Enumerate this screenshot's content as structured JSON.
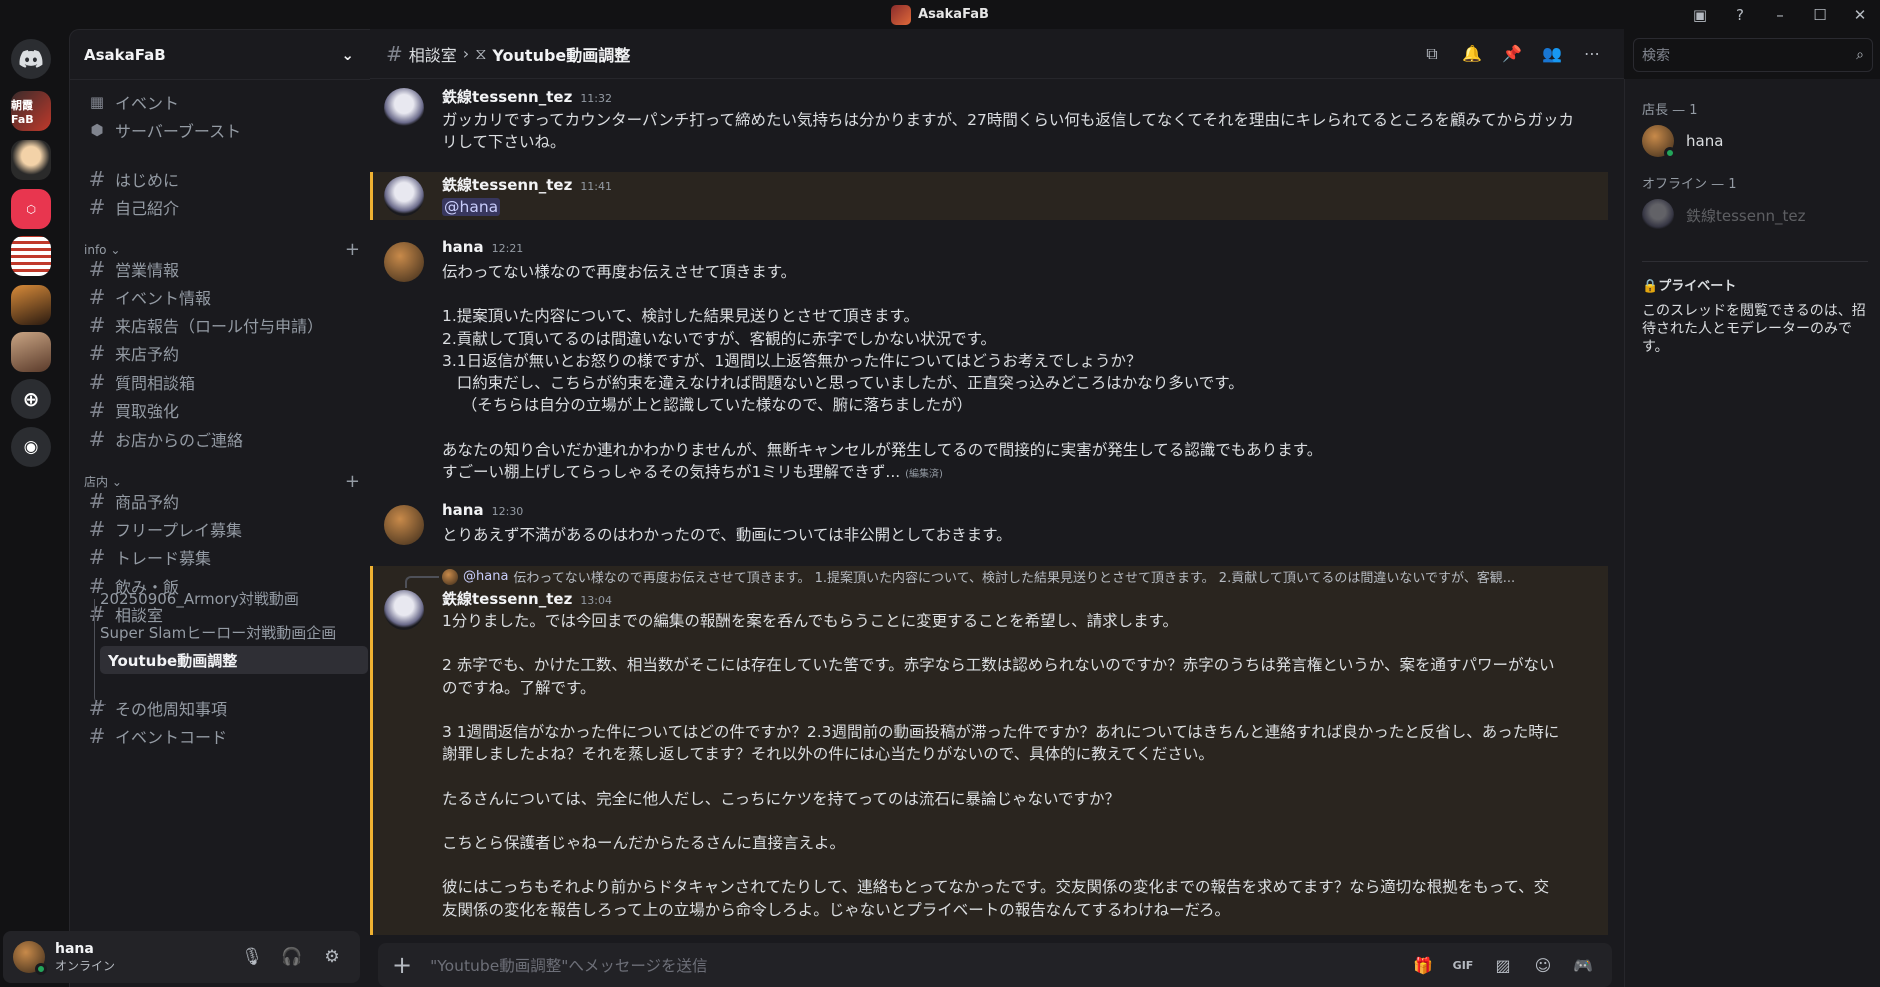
{
  "window": {
    "title": "AsakaFaB"
  },
  "servers": [
    {
      "name": "朝霞FaB"
    },
    {
      "name": "server-2"
    },
    {
      "name": "server-3"
    },
    {
      "name": "server-4"
    },
    {
      "name": "server-5"
    },
    {
      "name": "server-6"
    }
  ],
  "guild": {
    "name": "AsakaFaB"
  },
  "top_items": [
    {
      "label": "イベント"
    },
    {
      "label": "サーバーブースト"
    }
  ],
  "channels_top": [
    {
      "label": "はじめに"
    },
    {
      "label": "自己紹介"
    }
  ],
  "categories": [
    {
      "name": "info",
      "channels": [
        {
          "label": "営業情報"
        },
        {
          "label": "イベント情報"
        },
        {
          "label": "来店報告（ロール付与申請）"
        },
        {
          "label": "来店予約"
        },
        {
          "label": "質問相談箱"
        },
        {
          "label": "買取強化"
        },
        {
          "label": "お店からのご連絡"
        }
      ]
    },
    {
      "name": "店内",
      "channels": [
        {
          "label": "商品予約"
        },
        {
          "label": "フリープレイ募集"
        },
        {
          "label": "トレード募集"
        },
        {
          "label": "飲み・飯"
        },
        {
          "label": "相談室"
        }
      ]
    }
  ],
  "threads": [
    {
      "label": "20250906_Armory対戦動画"
    },
    {
      "label": "Super Slamヒーロー対戦動画企画"
    },
    {
      "label": "Youtube動画調整"
    }
  ],
  "channels_after": [
    {
      "label": "その他周知事項"
    },
    {
      "label": "イベントコード"
    }
  ],
  "user": {
    "name": "hana",
    "status": "オンライン"
  },
  "header": {
    "parent": "相談室",
    "thread": "Youtube動画調整"
  },
  "search": {
    "placeholder": "検索"
  },
  "messages": [
    {
      "author": "鉄線tessenn_tez",
      "time": "11:32",
      "body": "ガッカリですってカウンターパンチ打って締めたい気持ちは分かりますが、27時間くらい何も返信してなくてそれを理由にキレられてるところを顧みてからガッカリして下さいね。"
    },
    {
      "author": "鉄線tessenn_tez",
      "time": "11:41",
      "mention": "@hana"
    },
    {
      "author": "hana",
      "time": "12:21",
      "body": "伝わってない様なので再度お伝えさせて頂きます。\n\n1.提案頂いた内容について、検討した結果見送りとさせて頂きます。\n2.貢献して頂いてるのは間違いないですが、客観的に赤字でしかない状況です。\n3.1日返信が無いとお怒りの様ですが、1週間以上返答無かった件についてはどうお考えでしょうか？\n   口約束だし、こちらが約束を違えなければ問題ないと思っていましたが、正直突っ込みどころはかなり多いです。\n    （そちらは自分の立場が上と認識していた様なので、腑に落ちましたが）\n\nあなたの知り合いだか連れかわかりませんが、無断キャンセルが発生してるので間接的に実害が発生してる認識でもあります。\nすごーい棚上げしてらっしゃるその気持ちが1ミリも理解できず...",
      "edited": "(編集済)"
    },
    {
      "author": "hana",
      "time": "12:30",
      "body": "とりあえず不満があるのはわかったので、動画については非公開としておきます。"
    },
    {
      "author": "鉄線tessenn_tez",
      "time": "13:04",
      "reply_mention": "@hana",
      "reply_text": "伝わってない様なので再度お伝えさせて頂きます。 1.提案頂いた内容について、検討した結果見送りとさせて頂きます。 2.貢献して頂いてるのは間違いないですが、客観...",
      "body": "1分りました。では今回までの編集の報酬を案を呑んでもらうことに変更することを希望し、請求します。\n\n2 赤字でも、かけた工数、相当数がそこには存在していた筈です。赤字なら工数は認められないのですか？赤字のうちは発言権というか、案を通すパワーがないのですね。了解です。\n\n3 1週間返信がなかった件についてはどの件ですか？2.3週間前の動画投稿が滞った件ですか？あれについてはきちんと連絡すれば良かったと反省し、あった時に謝罪しましたよね？それを蒸し返してます？それ以外の件には心当たりがないので、具体的に教えてください。\n\nたるさんについては、完全に他人だし、こっちにケツを持てってのは流石に暴論じゃないですか？\n\nこちとら保護者じゃねーんだからたるさんに直接言えよ。\n\n彼にはこっちもそれより前からドタキャンされてたりして、連絡もとってなかったです。交友関係の変化までの報告を求めてます？なら適切な根拠をもって、交友関係の変化を報告しろって上の立場から命令しろよ。じゃないとプライベートの報告なんてするわけねーだろ。"
    }
  ],
  "composer": {
    "placeholder": "\"Youtube動画調整\"へメッセージを送信"
  },
  "members": {
    "online_header": "店長 — 1",
    "online": [
      {
        "name": "hana"
      }
    ],
    "offline_header": "オフライン — 1",
    "offline": [
      {
        "name": "鉄線tessenn_tez"
      }
    ],
    "private_title": "プライベート",
    "private_text": "このスレッドを閲覧できるのは、招待された人とモデレーターのみです。"
  },
  "colors": {
    "accent": "#f0b232",
    "online": "#23a55a",
    "mention": "#5865f2",
    "discord": "#5865f2"
  }
}
